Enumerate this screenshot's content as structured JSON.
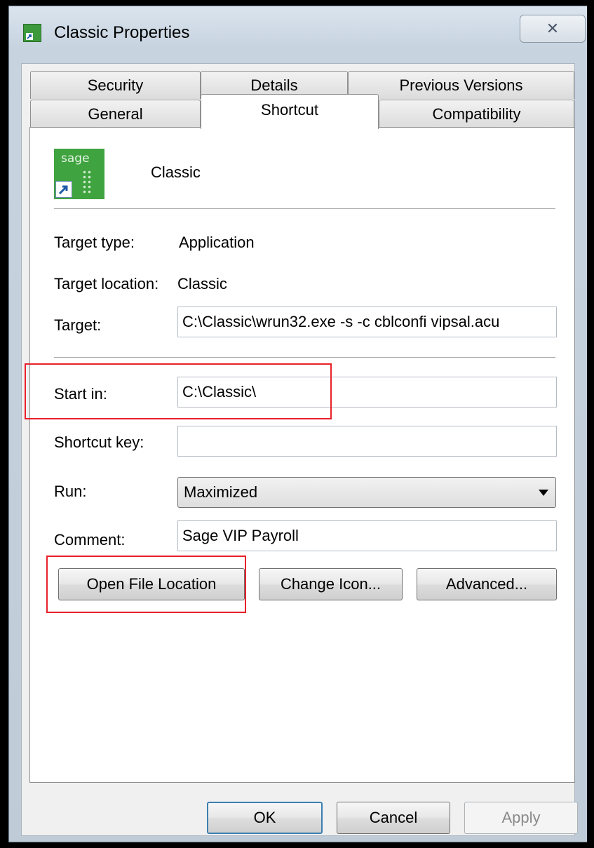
{
  "window": {
    "title": "Classic Properties",
    "close_glyph": "✕"
  },
  "tabs": {
    "row_back": [
      "Security",
      "Details",
      "Previous Versions"
    ],
    "row_front": [
      "General",
      "Shortcut",
      "Compatibility"
    ],
    "active": "Shortcut"
  },
  "header": {
    "icon": "sage-shortcut-icon",
    "icon_brand": "sage",
    "name": "Classic"
  },
  "fields": {
    "target_type_label": "Target type:",
    "target_type_value": "Application",
    "target_location_label": "Target location:",
    "target_location_value": "Classic",
    "target_label": "Target:",
    "target_value": "C:\\Classic\\wrun32.exe -s -c cblconfi vipsal.acu",
    "start_in_label": "Start in:",
    "start_in_value": "C:\\Classic\\",
    "shortcut_key_label": "Shortcut key:",
    "shortcut_key_value": "",
    "run_label": "Run:",
    "run_value": "Maximized",
    "comment_label": "Comment:",
    "comment_value": "Sage VIP Payroll"
  },
  "buttons": {
    "open_file_location": "Open File Location",
    "change_icon": "Change Icon...",
    "advanced": "Advanced...",
    "ok": "OK",
    "cancel": "Cancel",
    "apply": "Apply"
  },
  "annotations": {
    "color": "#e8202a"
  },
  "colors": {
    "sage_green": "#3fa33f",
    "default_button_border": "#3c7fb1"
  }
}
